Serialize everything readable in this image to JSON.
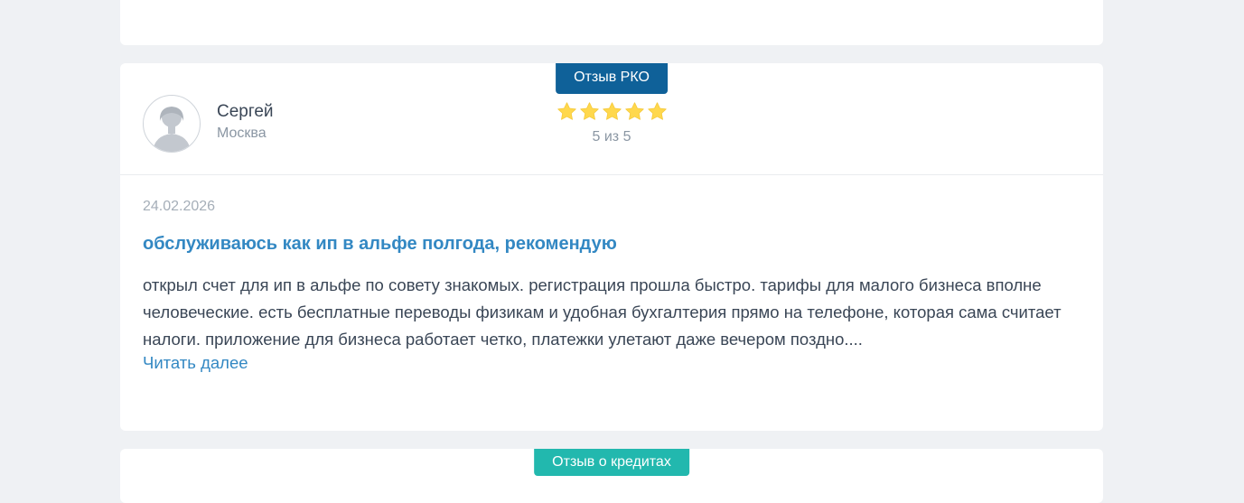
{
  "review": {
    "badge": "Отзыв РКО",
    "author": {
      "name": "Сергей",
      "city": "Москва"
    },
    "rating": {
      "stars": 5,
      "max": 5,
      "text": "5 из 5",
      "star_color": "#ffd84d"
    },
    "date": "24.02.2026",
    "title": "обслуживаюсь как ип в альфе полгода, рекомендую",
    "text": "открыл счет для ип в альфе по совету знакомых. регистрация прошла быстро. тарифы для малого бизнеса вполне человеческие. есть бесплатные переводы физикам и удобная бухгалтерия прямо на телефоне, которая сама считает налоги. приложение для бизнеса работает четко, платежки улетают даже вечером поздно....",
    "read_more": "Читать далее"
  },
  "next_review": {
    "badge": "Отзыв о кредитах"
  },
  "colors": {
    "background": "#eff1f4",
    "badge_rko": "#0f6199",
    "badge_credit": "#22b8ae",
    "accent": "#3388c3"
  }
}
